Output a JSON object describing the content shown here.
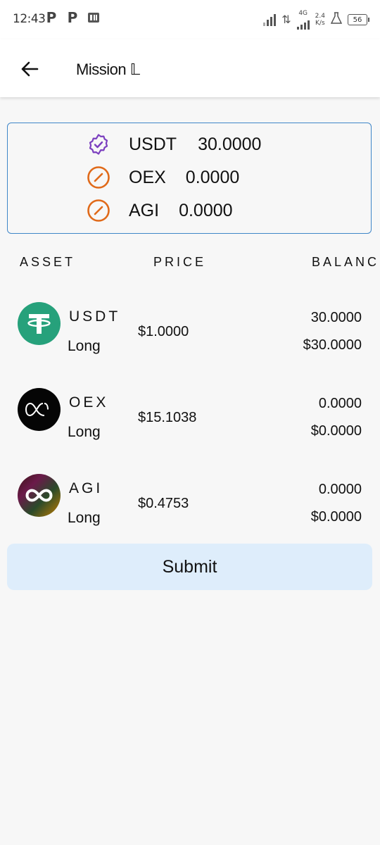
{
  "status_bar": {
    "time": "12:43",
    "left_icons": [
      "p-icon",
      "p-icon",
      "pdf-notification-icon"
    ],
    "net_type": "4G",
    "speed_value": "2.4",
    "speed_unit": "K/s",
    "battery": "56"
  },
  "header": {
    "title": "Mission 𝕃"
  },
  "balances": [
    {
      "symbol": "USDT",
      "amount": "30.0000",
      "status_icon": "verified-badge-icon",
      "color": "#7b3fbf"
    },
    {
      "symbol": "OEX",
      "amount": "0.0000",
      "status_icon": "prohibited-icon",
      "color": "#e06a1a"
    },
    {
      "symbol": "AGI",
      "amount": "0.0000",
      "status_icon": "prohibited-icon",
      "color": "#e06a1a"
    }
  ],
  "table": {
    "headers": [
      "ASSET",
      "PRICE",
      "BALANC"
    ],
    "rows": [
      {
        "symbol": "USDT",
        "direction": "Long",
        "price": "$1.0000",
        "balance": "30.0000",
        "value": "$30.0000",
        "logo": "tether-logo"
      },
      {
        "symbol": "OEX",
        "direction": "Long",
        "price": "$15.1038",
        "balance": "0.0000",
        "value": "$0.0000",
        "logo": "oex-logo"
      },
      {
        "symbol": "AGI",
        "direction": "Long",
        "price": "$0.4753",
        "balance": "0.0000",
        "value": "$0.0000",
        "logo": "agi-logo"
      }
    ]
  },
  "actions": {
    "submit_label": "Submit"
  },
  "colors": {
    "accent_border": "#3f86c8",
    "submit_bg": "#deedfb",
    "tether_green": "#26a17b"
  }
}
